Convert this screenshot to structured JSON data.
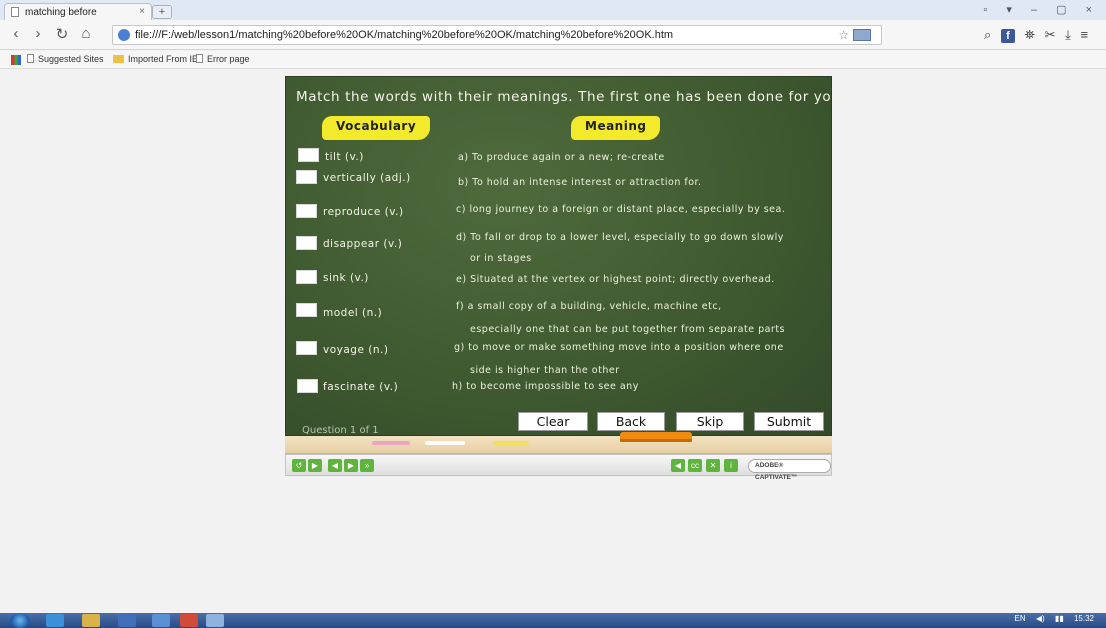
{
  "browser": {
    "tab_title": "matching before",
    "tab_close": "×",
    "new_tab": "+",
    "window_controls": "▫ ▾ – ▢ ×",
    "url": "file:///F:/web/lesson1/matching%20before%20OK/matching%20before%20OK/matching%20before%20OK.htm",
    "star": "☆",
    "bookmarks": [
      "Suggested Sites",
      "Imported From IE",
      "Error page"
    ]
  },
  "activity": {
    "instruction": "Match the words with their meanings. The first one has been done for you.",
    "vocab_header": "Vocabulary",
    "meaning_header": "Meaning",
    "words": [
      "tilt (v.)",
      "vertically (adj.)",
      "reproduce (v.)",
      "disappear (v.)",
      "sink (v.)",
      "model (n.)",
      "voyage (n.)",
      "fascinate (v.)"
    ],
    "meanings": [
      "a) To produce again or a new; re-create",
      "b) To hold an intense interest or attraction for.",
      "c) long journey to a foreign or distant place, especially by sea.",
      "d) To fall or drop to a lower level, especially to go down slowly",
      "or in stages",
      "e) Situated at the vertex or highest point; directly overhead.",
      "f) a small copy of a building, vehicle, machine etc,",
      "especially one that can be put together from separate parts",
      "g) to move or make something move into a position where one",
      "side is higher than the other",
      "h) to become impossible to see any"
    ],
    "question_counter": "Question 1 of 1",
    "buttons": {
      "clear": "Clear",
      "back": "Back",
      "skip": "Skip",
      "submit": "Submit"
    },
    "adobe_badge": "ADOBE® CAPTIVATE™"
  },
  "taskbar": {
    "language": "EN",
    "clock": "15:32"
  }
}
